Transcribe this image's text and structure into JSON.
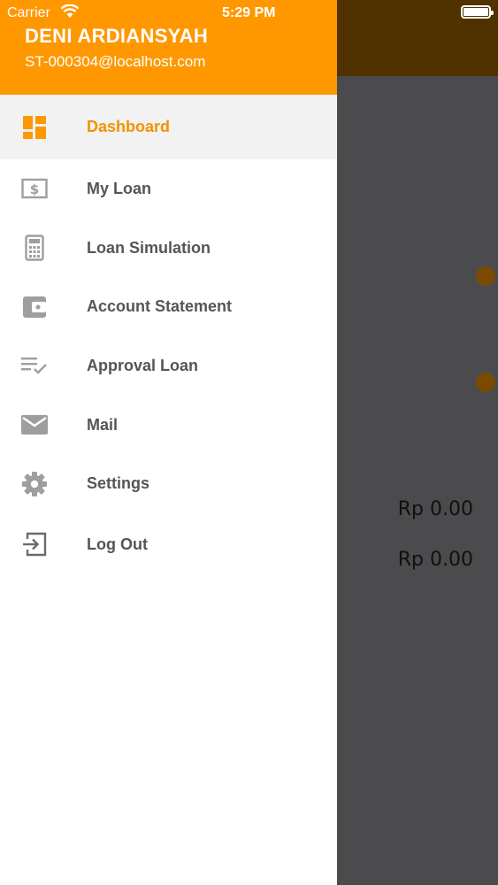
{
  "status_bar": {
    "carrier": "Carrier",
    "time": "5:29 PM"
  },
  "user": {
    "name": "DENI ARDIANSYAH",
    "email": "ST-000304@localhost.com"
  },
  "menu": [
    {
      "label": "Dashboard",
      "icon": "dashboard-icon",
      "active": true
    },
    {
      "label": "My Loan",
      "icon": "money-icon"
    },
    {
      "label": "Loan Simulation",
      "icon": "calculator-icon"
    },
    {
      "label": "Account Statement",
      "icon": "wallet-icon"
    },
    {
      "label": "Approval Loan",
      "icon": "checklist-icon"
    },
    {
      "label": "Mail",
      "icon": "mail-icon"
    },
    {
      "label": "Settings",
      "icon": "gear-icon"
    },
    {
      "label": "Log Out",
      "icon": "logout-icon"
    }
  ],
  "background": {
    "amount_1": "Rp 0.00",
    "amount_2": "Rp 0.00"
  },
  "colors": {
    "accent": "#ff9800",
    "active_label": "#f39200",
    "icon_gray": "#9e9e9e"
  }
}
